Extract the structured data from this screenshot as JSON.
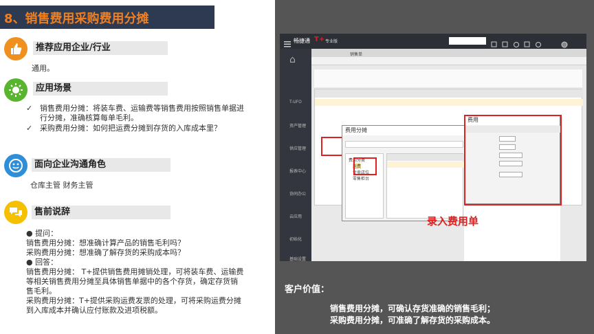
{
  "title": "8、销售费用采购费用分摊",
  "sections": {
    "industry": {
      "heading": "推荐应用企业/行业",
      "text": "通用。"
    },
    "scenario": {
      "heading": "应用场景",
      "items": [
        "销售费用分摊：将装车费、运输费等销售费用按照销售单据进",
        "行分摊，准确核算每单毛利。",
        "采购费用分摊：如何把运费分摊到存货的入库成本里？"
      ]
    },
    "roles": {
      "heading": "面向企业沟通角色",
      "text": "仓库主管  财务主管"
    },
    "presale": {
      "heading": "售前说辞",
      "lines": [
        "● 提问：",
        "销售费用分摊：想准确计算产品的销售毛利吗？",
        "采购费用分摊：想准确了解存货的采购成本吗？",
        "● 回答：",
        "销售费用分摊： T+提供销售费用摊销处理，可将装车费、运输费",
        "等相关销售费用分摊至具体销售单据中的各个存货，确定存货销",
        "售毛利。",
        "采购费用分摊：T+提供采购运费发票的处理，可将采购运费分摊",
        "到入库成本并确认应付账款及进项税额。"
      ]
    }
  },
  "screenshot": {
    "app_name": "畅捷通",
    "edition": "专业版",
    "tab": "销售单",
    "annotation": "录入费用单",
    "dialog_left_title": "费用分摊",
    "dialog_right_title": "费用",
    "tree_items": [
      "费用分类",
      "运费",
      "专卖店位",
      "零售柜台"
    ],
    "sidebar_items": [
      "T-UFO",
      "资产管理",
      "供应管理",
      "报表中心",
      "协同办公",
      "云应用",
      "初始化",
      "基础设置"
    ]
  },
  "customer_value": {
    "label": "客户价值：",
    "lines": [
      "销售费用分摊，可确认存货准确的销售毛利；",
      "采购费用分摊，可准确了解存货的采购成本。"
    ]
  },
  "colors": {
    "title_bg": "#2e3a52",
    "title_text": "#f07f1f",
    "accent_orange": "#f0901e",
    "accent_green": "#5ab52e",
    "accent_blue": "#2e8fd8",
    "accent_yellow": "#f5c000",
    "annotation_red": "#e02020",
    "right_bg": "#555555"
  }
}
